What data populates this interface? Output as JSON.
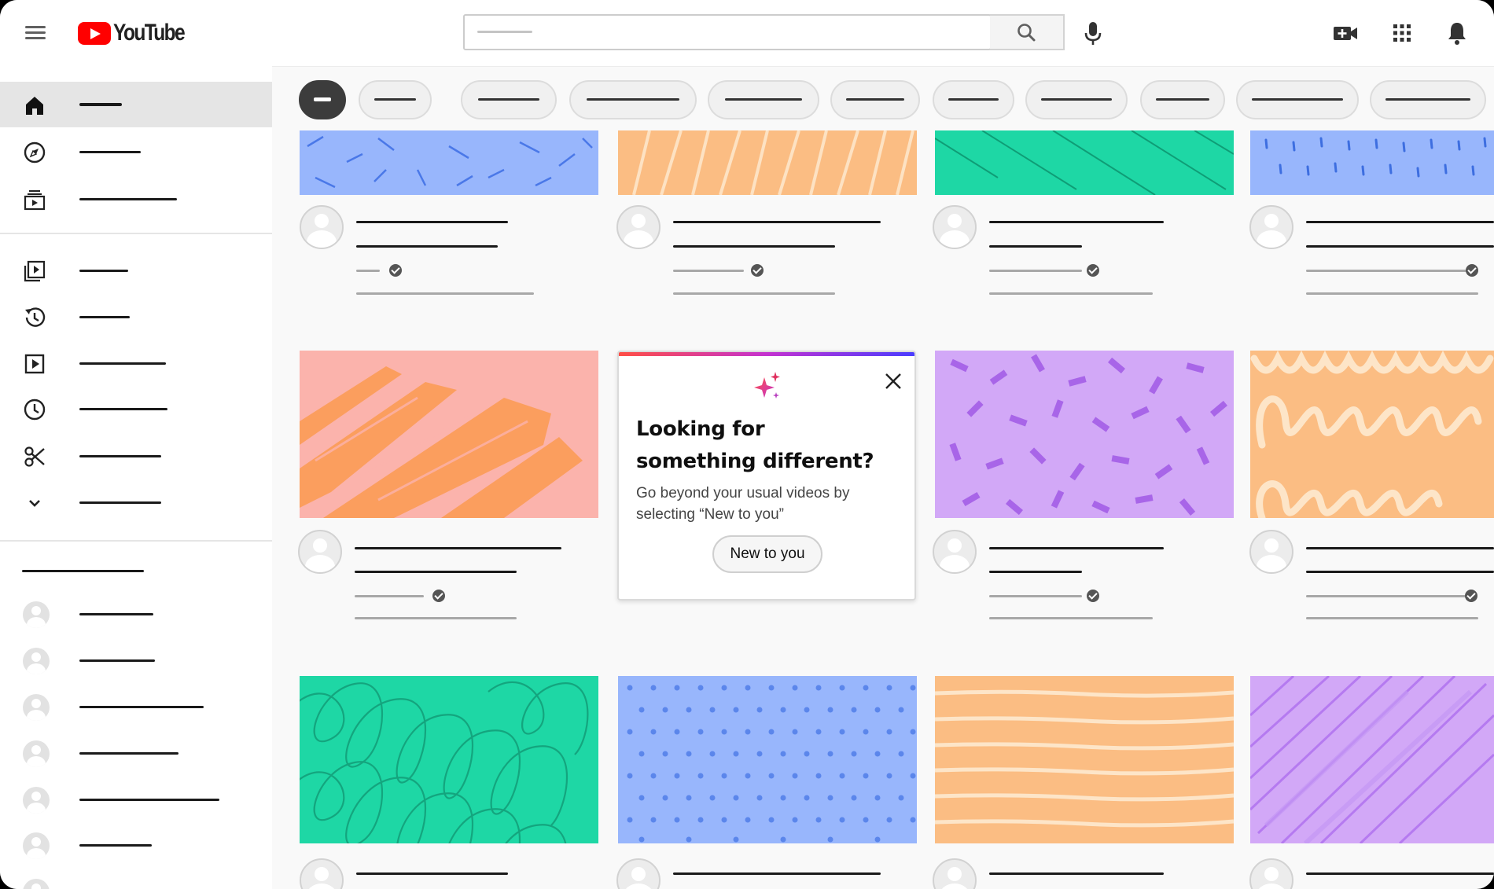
{
  "app": {
    "logo_text": "YouTube"
  },
  "colors": {
    "logo_red": "#ff0000",
    "thumb_blue": "#98b6fc",
    "thumb_orange": "#fbbd83",
    "thumb_green": "#1ed7a5",
    "thumb_purple": "#d2a8f7",
    "thumb_pink": "#fbb3ac",
    "popup_gradient": [
      "#ff4e45",
      "#c432d0",
      "#4a3cff"
    ]
  },
  "icons": {
    "menu": "hamburger-menu-icon",
    "search": "search-icon",
    "mic": "mic-icon",
    "create": "video-camera-plus-icon",
    "apps": "apps-grid-icon",
    "notifications": "bell-icon",
    "sidebar": [
      "home-icon",
      "compass-icon",
      "subscriptions-icon",
      "library-icon",
      "history-icon",
      "your-videos-icon",
      "watch-later-icon",
      "clips-icon",
      "chevron-down-icon"
    ]
  },
  "popup": {
    "title": "Looking for something different?",
    "description": "Go beyond your usual videos by selecting “New to you”",
    "button_label": "New to you",
    "icon": "sparkle-icon",
    "close_icon": "close-icon"
  }
}
